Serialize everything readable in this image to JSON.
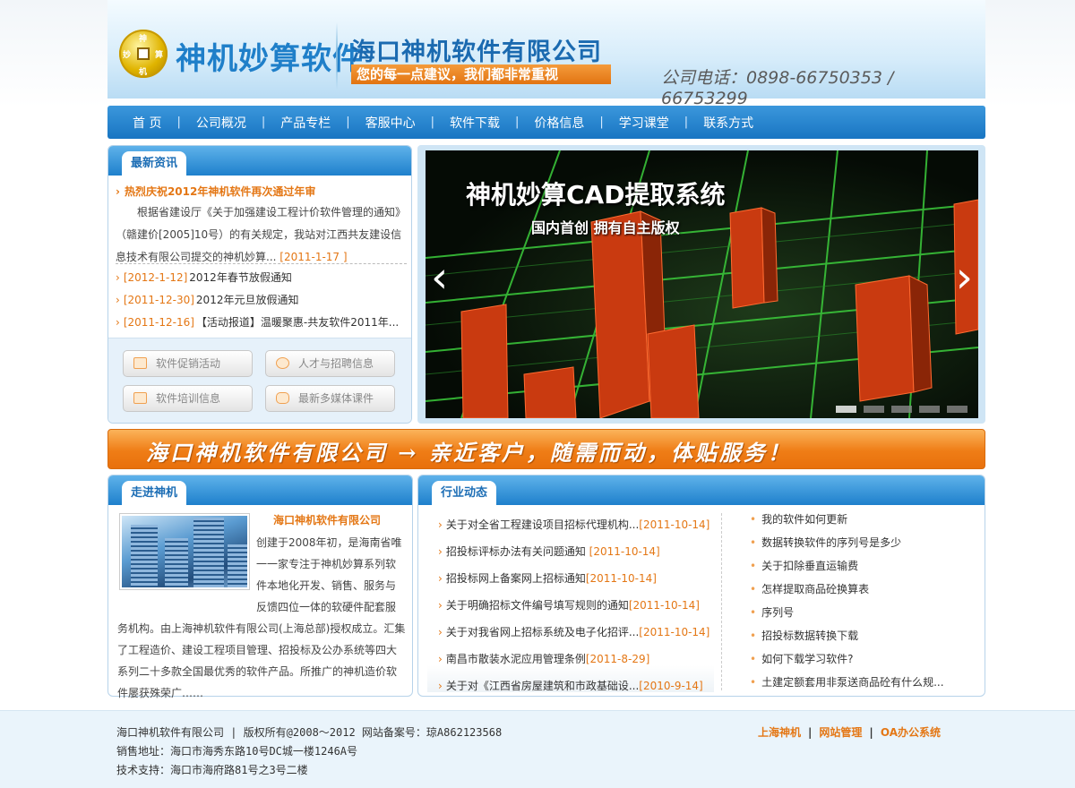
{
  "header": {
    "coin_glyphs": [
      "神",
      "机",
      "妙",
      "算"
    ],
    "brand": "神机妙算软件",
    "company": "海口神机软件有限公司",
    "slogan": "您的每一点建议，我们都非常重视",
    "phone": "公司电话：0898-66750353 / 66753299"
  },
  "nav": [
    "首 页",
    "公司概况",
    "产品专栏",
    "客服中心",
    "软件下载",
    "价格信息",
    "学习课堂",
    "联系方式"
  ],
  "news": {
    "tab": "最新资讯",
    "hot_title": "热烈庆祝2012年神机软件再次通过年审",
    "hot_body": "根据省建设厅《关于加强建设工程计价软件管理的通知》（赣建价[2005]10号）的有关规定，我站对江西共友建设信息技术有限公司提交的神机妙算...",
    "hot_date": "[2011-1-17 ]",
    "items": [
      {
        "date": "[2012-1-12]",
        "text": "2012年春节放假通知"
      },
      {
        "date": "[2011-12-30]",
        "text": "2012年元旦放假通知"
      },
      {
        "date": "[2011-12-16]",
        "text": "【活动报道】温暖聚惠-共友软件2011年..."
      }
    ],
    "buttons": [
      "软件促销活动",
      "人才与招聘信息",
      "软件培训信息",
      "最新多媒体课件"
    ]
  },
  "banner": {
    "title": "神机妙算CAD提取系统",
    "subtitle": "国内首创  拥有自主版权",
    "prev": "‹",
    "next": "›",
    "active_slide": 1,
    "slide_count": 5
  },
  "strip": "海口神机软件有限公司 → 亲近客户，随需而动，体贴服务！",
  "about": {
    "tab": "走进神机",
    "title": "海口神机软件有限公司",
    "body": "创建于2008年初，是海南省唯一一家专注于神机妙算系列软件本地化开发、销售、服务与反馈四位一体的软硬件配套服务机构。由上海神机软件有限公司(上海总部)授权成立。汇集了工程造价、建设工程项目管理、招投标及公办系统等四大系列二十多款全国最优秀的软件产品。所推广的神机造价软件屡获殊荣广……"
  },
  "industry": {
    "tab": "行业动态",
    "items": [
      {
        "text": "关于对全省工程建设项目招标代理机构...",
        "date": "[2011-10-14]"
      },
      {
        "text": "招投标评标办法有关问题通知 ",
        "date": "[2011-10-14]"
      },
      {
        "text": "招投标网上备案网上招标通知",
        "date": "[2011-10-14]"
      },
      {
        "text": "关于明确招标文件编号填写规则的通知",
        "date": "[2011-10-14]"
      },
      {
        "text": "关于对我省网上招标系统及电子化招评...",
        "date": "[2011-10-14]"
      },
      {
        "text": "南昌市散装水泥应用管理条例",
        "date": "[2011-8-29]"
      },
      {
        "text": "关于对《江西省房屋建筑和市政基础设...",
        "date": "[2010-9-14]"
      }
    ],
    "faq": [
      "我的软件如何更新",
      "数据转换软件的序列号是多少",
      "关于扣除垂直运输费",
      "怎样提取商品砼换算表",
      "序列号",
      "招投标数据转换下载",
      "如何下载学习软件?",
      "土建定额套用非泵送商品砼有什么规..."
    ]
  },
  "footer": {
    "line1": "海口神机软件有限公司 | 版权所有@2008～2012  网站备案号：琼A862123568",
    "line2": "销售地址：海口市海秀东路10号DC城一楼1246A号",
    "line3": "技术支持：海口市海府路81号之3号二楼",
    "links": [
      "上海神机",
      "网站管理",
      "OA办公系统"
    ]
  }
}
